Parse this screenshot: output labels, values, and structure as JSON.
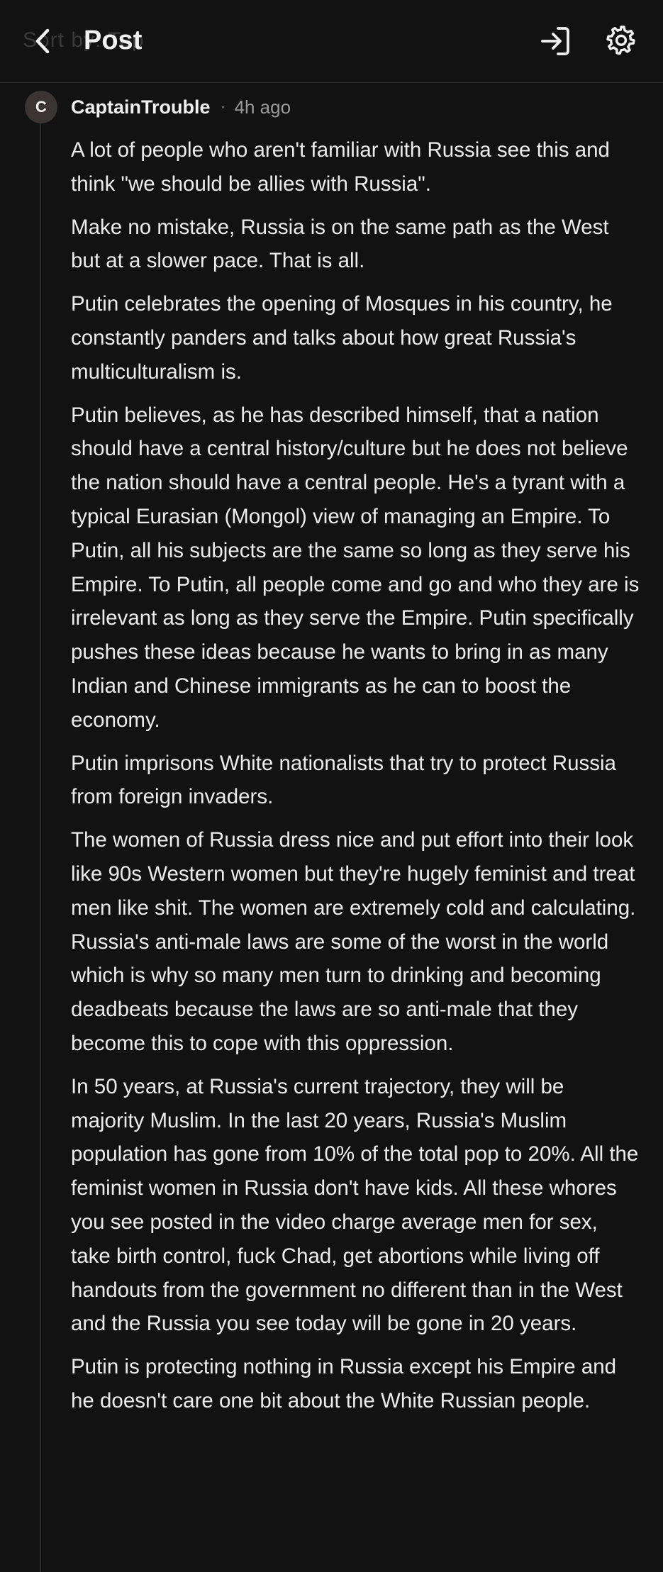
{
  "header": {
    "title": "Post",
    "ghost_text": "Sort by: Top",
    "back_icon": "chevron-left-icon",
    "login_icon": "login-icon",
    "settings_icon": "gear-icon"
  },
  "comment": {
    "avatar_letter": "C",
    "author": "CaptainTrouble",
    "separator": "·",
    "time": "4h ago",
    "paragraphs": [
      "A lot of people who aren't familiar with Russia see this and think \"we should be allies with Russia\".",
      "Make no mistake, Russia is on the same path as the West but at a slower pace. That is all.",
      "Putin celebrates the opening of Mosques in his country, he constantly panders and talks about how great Russia's multiculturalism is.",
      "Putin believes, as he has described himself, that a nation should have a central history/culture but he does not believe the nation should have a central people. He's a tyrant with a typical Eurasian (Mongol) view of managing an Empire. To Putin, all his subjects are the same so long as they serve his Empire. To Putin, all people come and go and who they are is irrelevant as long as they serve the Empire. Putin specifically pushes these ideas because he wants to bring in as many Indian and Chinese immigrants as he can to boost the economy.",
      "Putin imprisons White nationalists that try to protect Russia from foreign invaders.",
      "The women of Russia dress nice and put effort into their look like 90s Western women but they're hugely feminist and treat men like shit. The women are extremely cold and calculating. Russia's anti-male laws are some of the worst in the world which is why so many men turn to drinking and becoming deadbeats because the laws are so anti-male that they become this to cope with this oppression.",
      "In 50 years, at Russia's current trajectory, they will be majority Muslim. In the last 20 years, Russia's Muslim population has gone from 10% of the total pop to 20%. All the feminist women in Russia don't have kids. All these whores you see posted in the video charge average men for sex, take birth control, fuck Chad, get abortions while living off handouts from the government no different than in the West and the Russia you see today will be gone in 20 years.",
      "Putin is protecting nothing in Russia except his Empire and he doesn't care one bit about the White Russian people."
    ]
  },
  "colors": {
    "background": "#121212",
    "text": "#ececec",
    "muted": "#9a9a9a",
    "avatar_bg": "#3b3433"
  }
}
